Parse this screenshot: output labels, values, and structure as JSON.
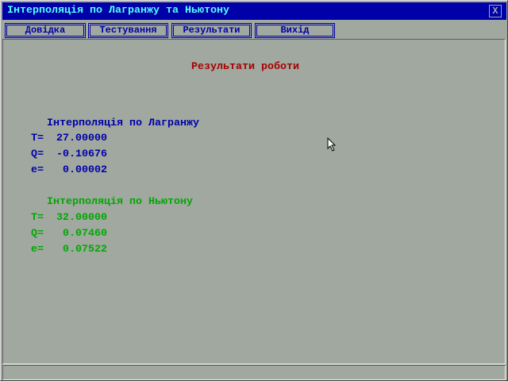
{
  "window": {
    "title": "Інтерполяція по Лагранжу та Ньютону",
    "close_label": "X"
  },
  "menu": [
    "Довідка",
    "Тестування",
    "Результати",
    "Вихід"
  ],
  "results": {
    "heading": "Результати роботи",
    "lagrange": {
      "title": "Інтерполяція по Лагранжу",
      "T": "T=  27.00000",
      "Q": "Q=  -0.10676",
      "e": "e=   0.00002"
    },
    "newton": {
      "title": "Інтерполяція по Ньютону",
      "T": "T=  32.00000",
      "Q": "Q=   0.07460",
      "e": "e=   0.07522"
    }
  },
  "colors": {
    "title_bg": "#0000a8",
    "title_fg": "#55ffff",
    "heading": "#a80000",
    "lagrange": "#0000a8",
    "newton": "#00a800",
    "background": "#a0a8a0"
  }
}
